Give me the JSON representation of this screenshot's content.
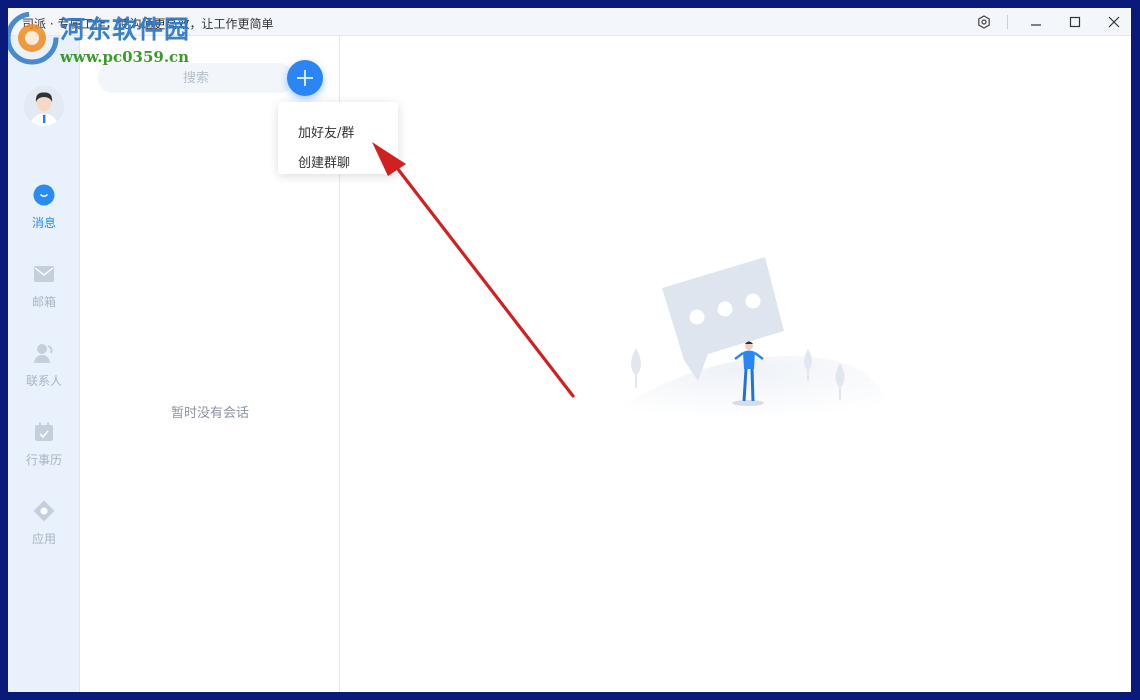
{
  "window": {
    "title": "司派 · 专属工作，使沟通更高效，让工作更简单",
    "controls": [
      "settings",
      "minimize",
      "maximize",
      "close"
    ]
  },
  "watermark": {
    "name": "河东软件园",
    "url": "www.pc0359.cn"
  },
  "nav": {
    "items": [
      {
        "label": "消息",
        "icon": "chat-bubble-icon",
        "active": true
      },
      {
        "label": "邮箱",
        "icon": "mail-icon",
        "active": false
      },
      {
        "label": "联系人",
        "icon": "contacts-icon",
        "active": false
      },
      {
        "label": "行事历",
        "icon": "calendar-icon",
        "active": false
      },
      {
        "label": "应用",
        "icon": "apps-icon",
        "active": false
      }
    ]
  },
  "conversation_list": {
    "search_placeholder": "搜索",
    "empty_text": "暂时没有会话"
  },
  "add_menu": {
    "items": [
      {
        "label": "加好友/群"
      },
      {
        "label": "创建群聊"
      }
    ]
  },
  "colors": {
    "accent": "#2a86f4",
    "nav_background": "#e9f1fc",
    "annotation_arrow": "#d21f1f",
    "window_border": "#0a1a7a"
  }
}
